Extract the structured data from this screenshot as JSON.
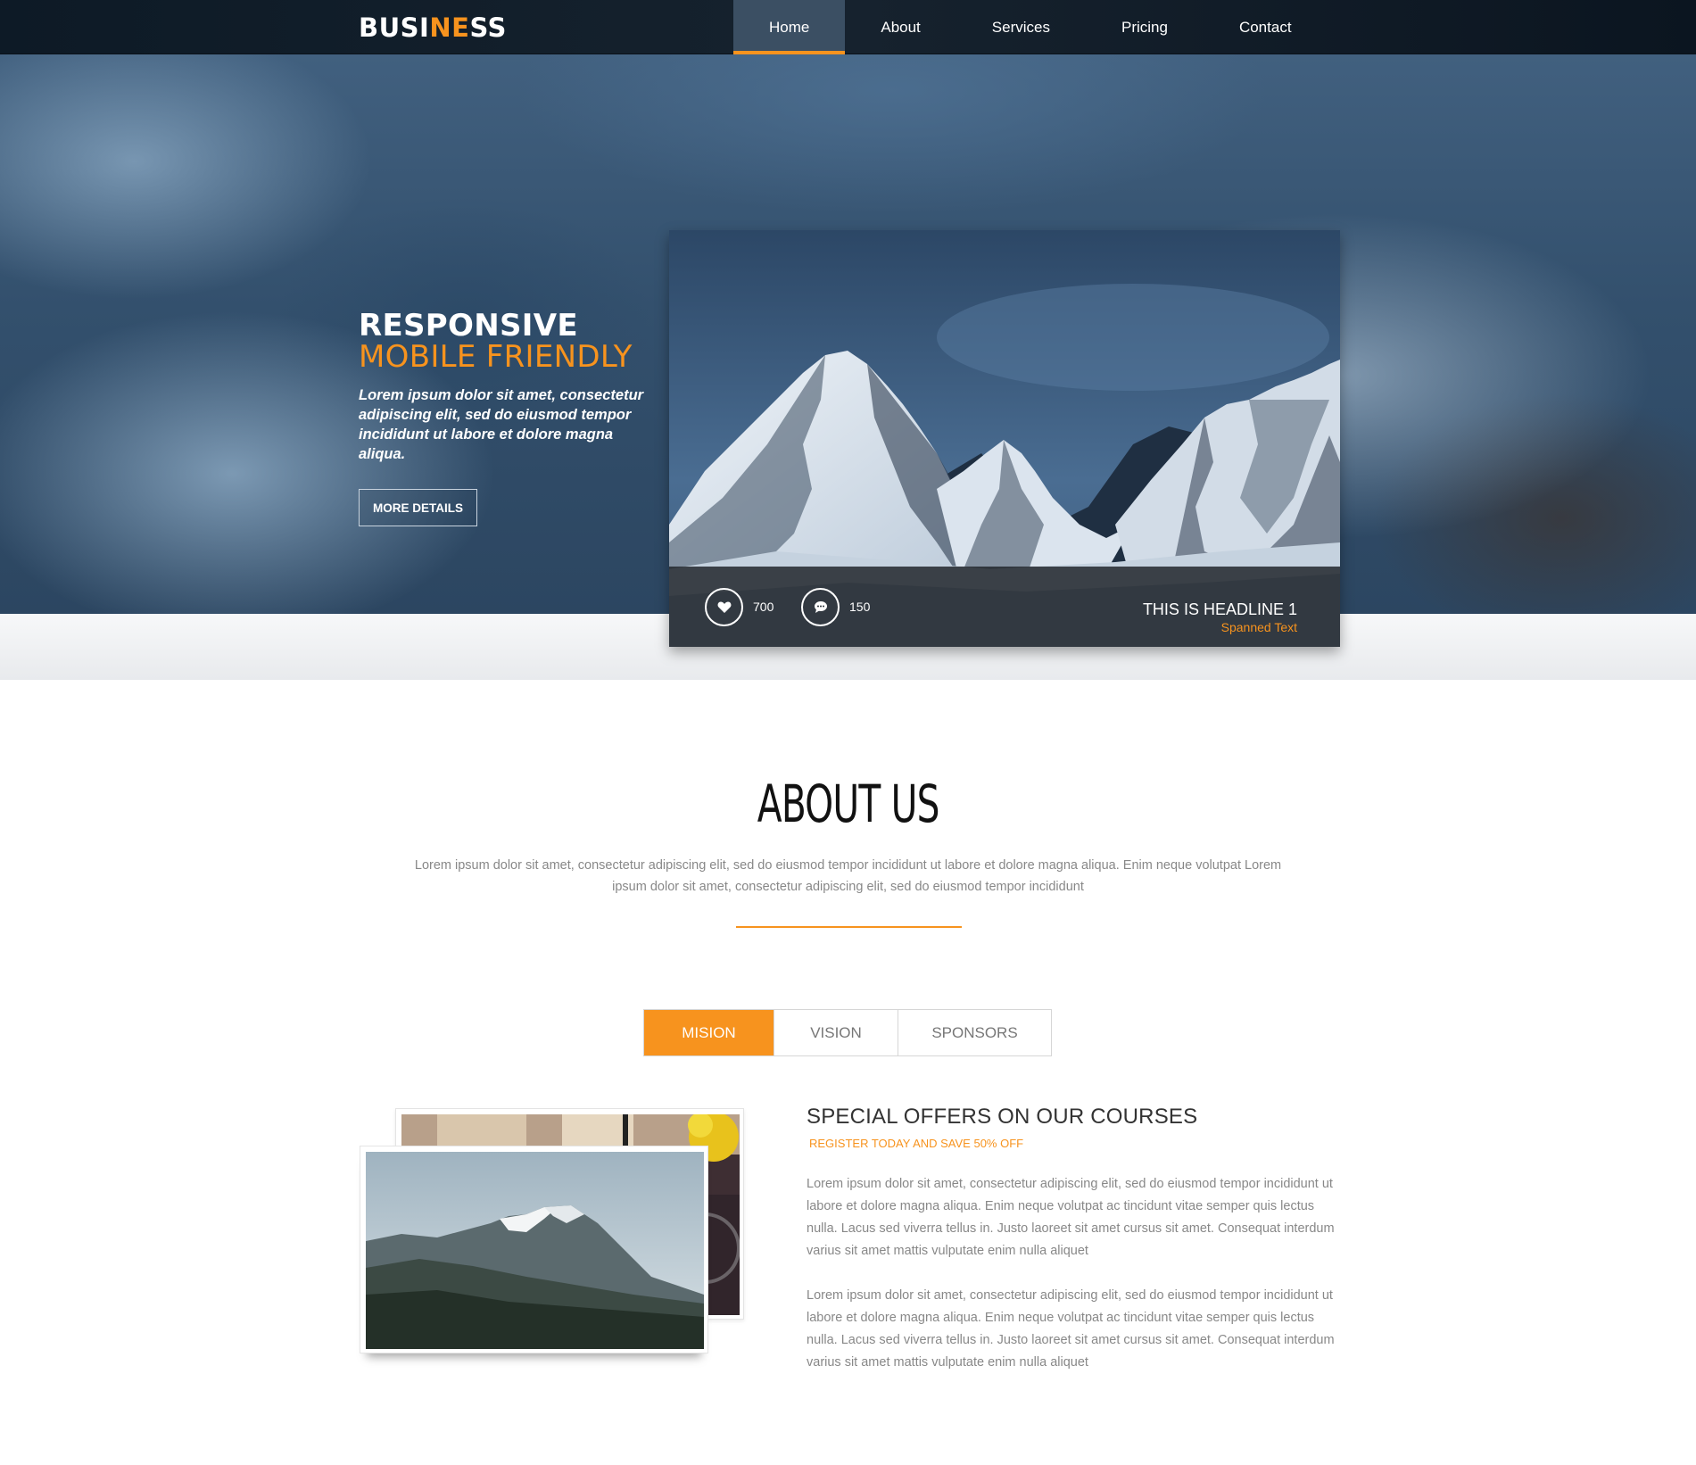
{
  "brand": {
    "logo_part1": "BUSI",
    "logo_accent": "NE",
    "logo_part2": "SS",
    "accent_color": "#f7931e"
  },
  "nav": {
    "items": [
      {
        "label": "Home",
        "active": true
      },
      {
        "label": "About",
        "active": false
      },
      {
        "label": "Services",
        "active": false
      },
      {
        "label": "Pricing",
        "active": false
      },
      {
        "label": "Contact",
        "active": false
      }
    ]
  },
  "hero": {
    "title_line1": "RESPONSIVE",
    "title_line2": "MOBILE FRIENDLY",
    "text": "Lorem ipsum dolor sit amet, consectetur adipiscing elit, sed do eiusmod tempor incididunt ut labore et dolore magna aliqua.",
    "button_label": "MORE DETAILS",
    "card": {
      "likes": "700",
      "comments": "150",
      "headline": "THIS IS HEADLINE 1",
      "subtext": "Spanned Text",
      "like_icon": "heart-icon",
      "comment_icon": "speech-bubble-icon"
    }
  },
  "about": {
    "title": "ABOUT US",
    "text": "Lorem ipsum dolor sit amet, consectetur adipiscing elit, sed do eiusmod tempor incididunt ut labore et dolore magna aliqua. Enim neque volutpat Lorem ipsum dolor sit amet, consectetur adipiscing elit, sed do eiusmod tempor incididunt"
  },
  "tabs": [
    {
      "label": "MISION",
      "active": true
    },
    {
      "label": "VISION",
      "active": false
    },
    {
      "label": "SPONSORS",
      "active": false
    }
  ],
  "offer": {
    "title": "SPECIAL OFFERS ON OUR COURSES",
    "subtitle": "REGISTER TODAY AND SAVE 50% OFF",
    "paragraph1": "Lorem ipsum dolor sit amet, consectetur adipiscing elit, sed do eiusmod tempor incididunt ut labore et dolore magna aliqua. Enim neque volutpat ac tincidunt vitae semper quis lectus nulla. Lacus sed viverra tellus in. Justo laoreet sit amet cursus sit amet. Consequat interdum varius sit amet mattis vulputate enim nulla aliquet",
    "paragraph2": "Lorem ipsum dolor sit amet, consectetur adipiscing elit, sed do eiusmod tempor incididunt ut labore et dolore magna aliqua. Enim neque volutpat ac tincidunt vitae semper quis lectus nulla. Lacus sed viverra tellus in. Justo laoreet sit amet cursus sit amet. Consequat interdum varius sit amet mattis vulputate enim nulla aliquet"
  }
}
